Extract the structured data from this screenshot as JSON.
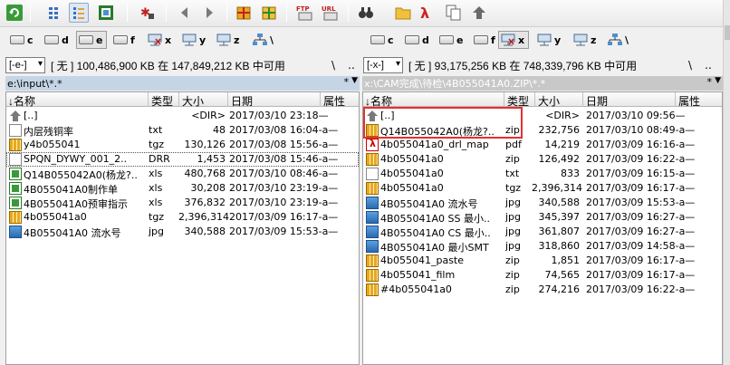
{
  "toolbar": {
    "buttons": [
      {
        "icon": "refresh-icon"
      },
      {
        "icon": "brief-view-icon"
      },
      {
        "icon": "detailed-view-icon"
      },
      {
        "icon": "thumbnail-view-icon"
      },
      {
        "icon": "select-files-icon"
      },
      {
        "icon": "back-icon"
      },
      {
        "icon": "forward-icon"
      },
      {
        "icon": "pack-files-icon"
      },
      {
        "icon": "unpack-files-icon"
      },
      {
        "icon": "ftp-connect-icon"
      },
      {
        "icon": "url-connect-icon"
      },
      {
        "icon": "search-binoculars-icon"
      },
      {
        "icon": "folder-icon"
      },
      {
        "icon": "pdf-icon"
      },
      {
        "icon": "copy-icon"
      },
      {
        "icon": "parent-folder-icon"
      }
    ],
    "ftp_label": "FTP",
    "url_label": "URL"
  },
  "left": {
    "drives": [
      "c",
      "d",
      "e",
      "f",
      "x",
      "y",
      "z",
      "\\"
    ],
    "active_drive": "e",
    "drive_selector": "[-e-]",
    "free_space": "[ 无 ]  100,486,900 KB 在 147,849,212 KB 中可用",
    "backslash": "\\",
    "parent": "..",
    "path": "e:\\input\\*.*",
    "star": "*",
    "columns": {
      "name": "↓名称",
      "ext": "类型",
      "size": "大小",
      "date": "日期",
      "attr": "属性"
    },
    "files": [
      {
        "icon": "up-icon",
        "name": "[..]",
        "ext": "",
        "size": "<DIR>",
        "date": "2017/03/10 23:18—"
      },
      {
        "icon": "txt-icon",
        "name": "内层残铜率",
        "ext": "txt",
        "size": "48",
        "date": "2017/03/08 16:04-a—"
      },
      {
        "icon": "zip-icon",
        "name": "y4b055041",
        "ext": "tgz",
        "size": "130,126",
        "date": "2017/03/08 15:56-a—"
      },
      {
        "icon": "drr-icon",
        "name": "SPQN_DYWY_001_2..",
        "ext": "DRR",
        "size": "1,453",
        "date": "2017/03/08 15:46-a—"
      },
      {
        "icon": "xls-icon",
        "name": "Q14B055042A0(杨龙?..",
        "ext": "xls",
        "size": "480,768",
        "date": "2017/03/10 08:46-a—"
      },
      {
        "icon": "xls-icon",
        "name": "4B055041A0制作单",
        "ext": "xls",
        "size": "30,208",
        "date": "2017/03/10 23:19-a—"
      },
      {
        "icon": "xls-icon",
        "name": "4B055041A0预审指示",
        "ext": "xls",
        "size": "376,832",
        "date": "2017/03/10 23:19-a—"
      },
      {
        "icon": "zip-icon",
        "name": "4b055041a0",
        "ext": "tgz",
        "size": "2,396,314",
        "date": "2017/03/09 16:17-a—"
      },
      {
        "icon": "jpg-icon",
        "name": "4B055041A0 流水号",
        "ext": "jpg",
        "size": "340,588",
        "date": "2017/03/09 15:53-a—"
      }
    ]
  },
  "right": {
    "drives": [
      "c",
      "d",
      "e",
      "f",
      "x",
      "y",
      "z",
      "\\"
    ],
    "active_drive": "x",
    "drive_selector": "[-x-]",
    "free_space": "[ 无 ]  93,175,256 KB 在 748,339,796 KB 中可用",
    "backslash": "\\",
    "parent": "..",
    "path": "x:\\CAM完成\\待检\\4B055041A0.ZIP\\*.*",
    "star": "*",
    "columns": {
      "name": "↓名称",
      "ext": "类型",
      "size": "大小",
      "date": "日期",
      "attr": "属性"
    },
    "files": [
      {
        "icon": "up-icon",
        "name": "[..]",
        "ext": "",
        "size": "<DIR>",
        "date": "2017/03/10 09:56—"
      },
      {
        "icon": "zip-icon",
        "name": "Q14B055042A0(杨龙?..",
        "ext": "zip",
        "size": "232,756",
        "date": "2017/03/10 08:49-a—"
      },
      {
        "icon": "pdf-icon",
        "name": "4b055041a0_drl_map",
        "ext": "pdf",
        "size": "14,219",
        "date": "2017/03/09 16:16-a—"
      },
      {
        "icon": "zip-icon",
        "name": "4b055041a0",
        "ext": "zip",
        "size": "126,492",
        "date": "2017/03/09 16:22-a—"
      },
      {
        "icon": "txt-icon",
        "name": "4b055041a0",
        "ext": "txt",
        "size": "833",
        "date": "2017/03/09 16:15-a—"
      },
      {
        "icon": "zip-icon",
        "name": "4b055041a0",
        "ext": "tgz",
        "size": "2,396,314",
        "date": "2017/03/09 16:17-a—"
      },
      {
        "icon": "jpg-icon",
        "name": "4B055041A0 流水号",
        "ext": "jpg",
        "size": "340,588",
        "date": "2017/03/09 15:53-a—"
      },
      {
        "icon": "jpg-icon",
        "name": "4B055041A0 SS 最小..",
        "ext": "jpg",
        "size": "345,397",
        "date": "2017/03/09 16:27-a—"
      },
      {
        "icon": "jpg-icon",
        "name": "4B055041A0 CS 最小..",
        "ext": "jpg",
        "size": "361,807",
        "date": "2017/03/09 16:27-a—"
      },
      {
        "icon": "jpg-icon",
        "name": "4B055041A0  最小SMT",
        "ext": "jpg",
        "size": "318,860",
        "date": "2017/03/09 14:58-a—"
      },
      {
        "icon": "zip-icon",
        "name": "4b055041_paste",
        "ext": "zip",
        "size": "1,851",
        "date": "2017/03/09 16:17-a—"
      },
      {
        "icon": "zip-icon",
        "name": "4b055041_film",
        "ext": "zip",
        "size": "74,565",
        "date": "2017/03/09 16:17-a—"
      },
      {
        "icon": "zip-icon",
        "name": "#4b055041a0",
        "ext": "zip",
        "size": "274,216",
        "date": "2017/03/09 16:22-a—"
      }
    ]
  },
  "colors": {
    "highlight": "#e53030",
    "active_path": "#c5d5e6",
    "folder": "#e6b53a"
  }
}
